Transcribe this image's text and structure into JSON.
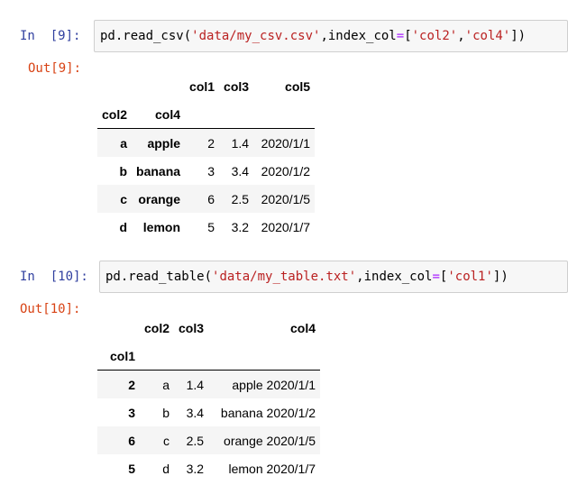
{
  "cells": [
    {
      "in_prompt": "In  [9]:",
      "out_prompt": "Out[9]:",
      "code": {
        "func": "pd.read_csv(",
        "arg1": "'data/my_csv.csv'",
        "comma1": ",index_col",
        "eq": "=",
        "lb": "[",
        "key1": "'col2'",
        "comma2": ",",
        "key2": "'col4'",
        "rb": "])"
      },
      "table": {
        "col_headers": [
          "col1",
          "col3",
          "col5"
        ],
        "index_names": [
          "col2",
          "col4"
        ],
        "rows": [
          {
            "idx": [
              "a",
              "apple"
            ],
            "vals": [
              "2",
              "1.4",
              "2020/1/1"
            ]
          },
          {
            "idx": [
              "b",
              "banana"
            ],
            "vals": [
              "3",
              "3.4",
              "2020/1/2"
            ]
          },
          {
            "idx": [
              "c",
              "orange"
            ],
            "vals": [
              "6",
              "2.5",
              "2020/1/5"
            ]
          },
          {
            "idx": [
              "d",
              "lemon"
            ],
            "vals": [
              "5",
              "3.2",
              "2020/1/7"
            ]
          }
        ]
      }
    },
    {
      "in_prompt": "In  [10]:",
      "out_prompt": "Out[10]:",
      "code": {
        "func": "pd.read_table(",
        "arg1": "'data/my_table.txt'",
        "comma1": ",index_col",
        "eq": "=",
        "lb": "[",
        "key1": "'col1'",
        "rb": "])"
      },
      "table": {
        "col_headers": [
          "col2",
          "col3",
          "col4"
        ],
        "index_names": [
          "col1"
        ],
        "rows": [
          {
            "idx": [
              "2"
            ],
            "vals": [
              "a",
              "1.4",
              "apple 2020/1/1"
            ]
          },
          {
            "idx": [
              "3"
            ],
            "vals": [
              "b",
              "3.4",
              "banana 2020/1/2"
            ]
          },
          {
            "idx": [
              "6"
            ],
            "vals": [
              "c",
              "2.5",
              "orange 2020/1/5"
            ]
          },
          {
            "idx": [
              "5"
            ],
            "vals": [
              "d",
              "3.2",
              "lemon 2020/1/7"
            ]
          }
        ]
      }
    }
  ]
}
